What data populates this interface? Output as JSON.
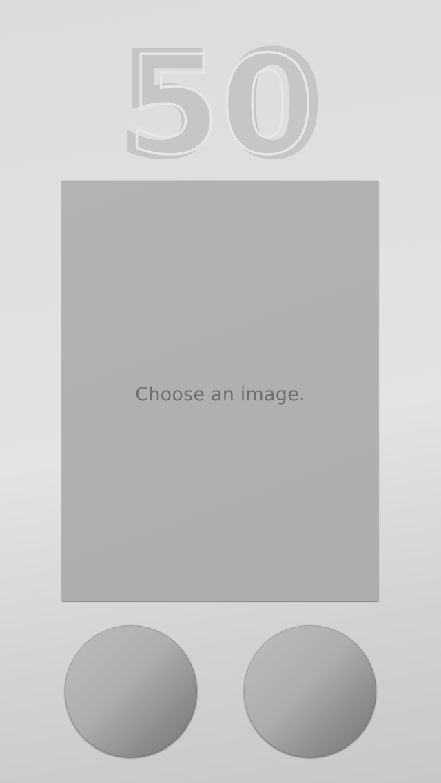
{
  "logo": {
    "text": "50"
  },
  "card": {
    "placeholder": "Choose an image."
  },
  "buttons": {
    "left_icon": "none",
    "right_icon": "none"
  },
  "colors": {
    "background": "#dcdcdc",
    "card": "#b0b0b0",
    "logo": "#c6c6c6",
    "label": "#6f6f6f"
  }
}
